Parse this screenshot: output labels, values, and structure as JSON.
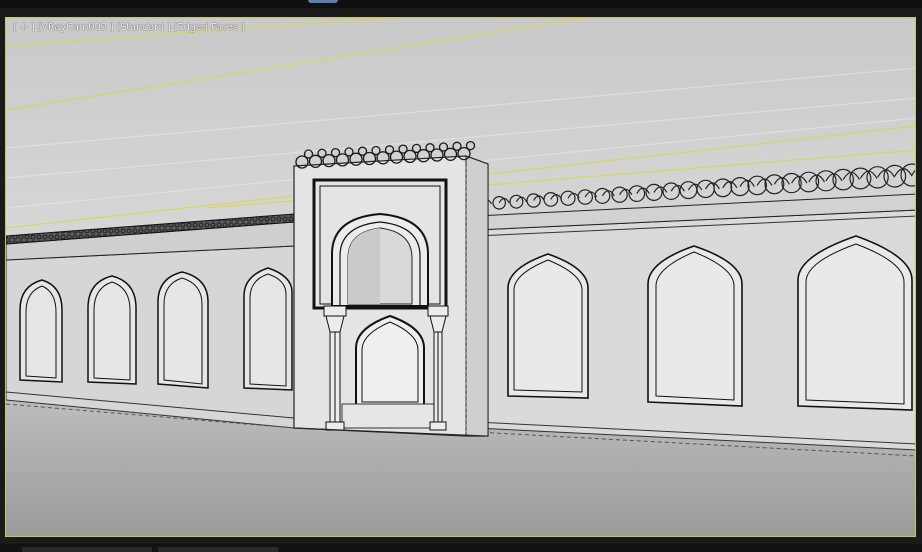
{
  "viewport": {
    "label_plus": "[ + ]",
    "label_camera": "[VRayCam003 ]",
    "label_shading": "[Standard ]",
    "label_display": "[Edged Faces ]",
    "border_color": "#c9c75a",
    "background_color": "#1a1a1a"
  }
}
